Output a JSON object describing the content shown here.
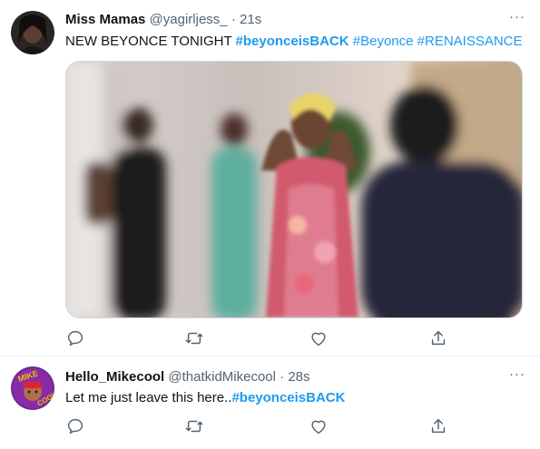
{
  "tweets": [
    {
      "display_name": "Miss Mamas",
      "handle": "@yagirljess_",
      "separator": "·",
      "time": "21s",
      "text_prefix": "NEW BEYONCE TONIGHT ",
      "hashtags": [
        "#beyonceisBACK",
        "#Beyonce",
        "#RENAISSANCE"
      ],
      "media": "blurred reality-TV scene: blonde woman holding her head, people around her",
      "more": "···"
    },
    {
      "display_name": "Hello_Mikecool",
      "handle": "@thatkidMikecool",
      "separator": "·",
      "time": "28s",
      "text_prefix": "Let me just leave this here..",
      "hashtags": [
        "#beyonceisBACK"
      ],
      "more": "···"
    }
  ],
  "actions": [
    "reply-icon",
    "retweet-icon",
    "like-icon",
    "share-icon"
  ],
  "colors": {
    "link": "#1d9bf0",
    "secondary": "#536471",
    "text": "#0f1419"
  }
}
